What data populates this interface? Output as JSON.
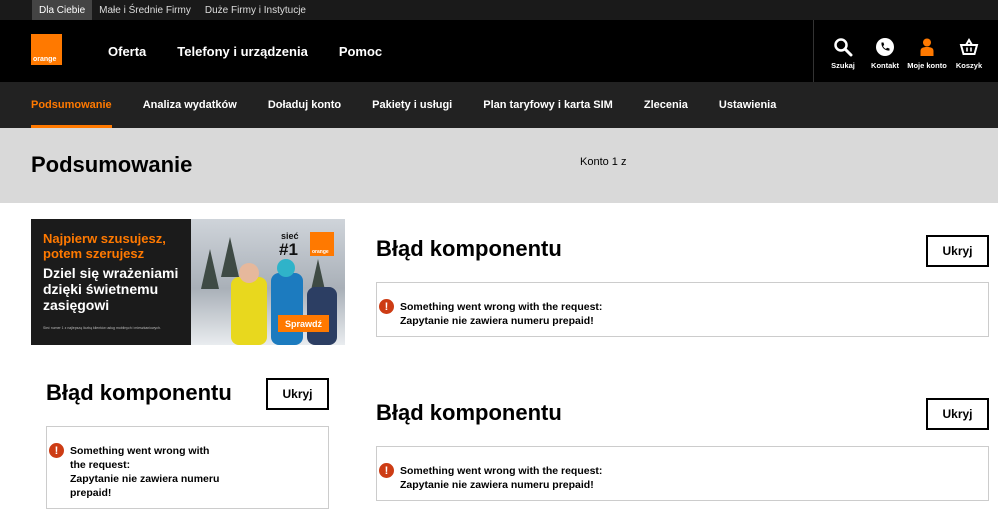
{
  "topbar": {
    "items": [
      "Dla Ciebie",
      "Małe i Średnie Firmy",
      "Duże Firmy i Instytucje"
    ]
  },
  "header": {
    "logo_text": "orange",
    "nav": [
      "Oferta",
      "Telefony i urządzenia",
      "Pomoc"
    ],
    "tools": [
      "Szukaj",
      "Kontakt",
      "Moje konto",
      "Koszyk"
    ]
  },
  "subnav": {
    "items": [
      "Podsumowanie",
      "Analiza wydatków",
      "Doładuj konto",
      "Pakiety i usługi",
      "Plan taryfowy i karta SIM",
      "Zlecenia",
      "Ustawienia"
    ]
  },
  "page": {
    "title": "Podsumowanie",
    "account": "Konto 1 z"
  },
  "banner": {
    "headline": "Najpierw szusujesz,\npotem szerujesz",
    "subheadline": "Dziel się wrażeniami dzięki świetnemu zasięgowi",
    "fineprint": "Sieć numer 1 z najlepszą liczbą klientów usług mobilnych i mieszkaniowych.",
    "badge_top": "sieć",
    "badge_num": "#1",
    "logo_text": "orange",
    "cta": "Sprawdź"
  },
  "components": [
    {
      "title": "Błąd komponentu",
      "button": "Ukryj",
      "error_line1": "Something went wrong with the request:",
      "error_line2": "Zapytanie nie zawiera numeru prepaid!"
    },
    {
      "title": "Błąd komponentu",
      "button": "Ukryj",
      "error_line1": "Something went wrong with the request:",
      "error_line2": "Zapytanie nie zawiera numeru prepaid!"
    },
    {
      "title": "Błąd komponentu",
      "button": "Ukryj",
      "error_lines": [
        "Something went wrong with",
        "the request:",
        "Zapytanie nie zawiera numeru",
        "prepaid!"
      ]
    }
  ],
  "colors": {
    "brand": "#ff7900",
    "error": "#cd3c14"
  }
}
